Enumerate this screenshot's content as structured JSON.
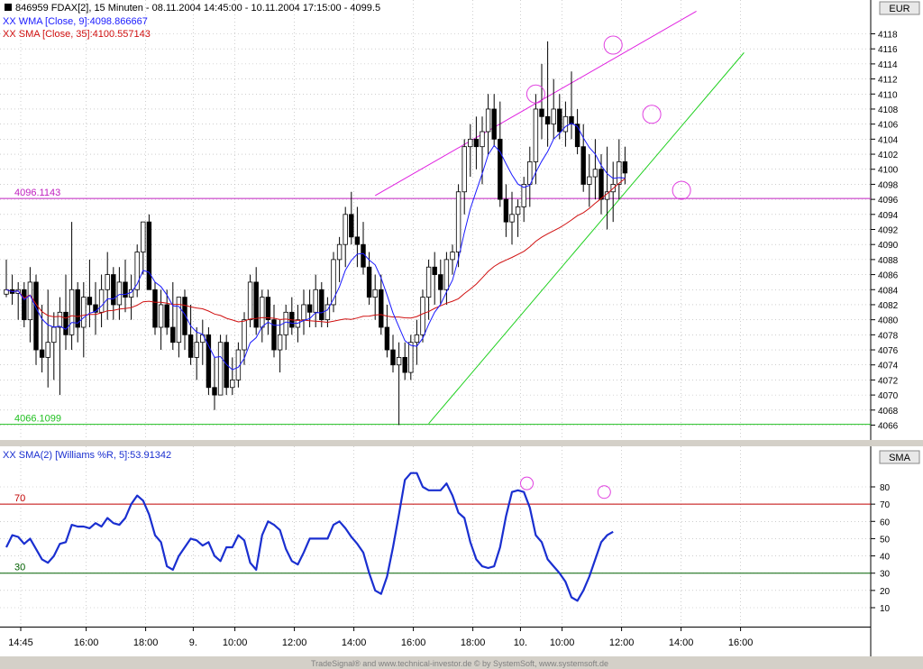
{
  "header": {
    "symbol_line": "846959  FDAX[2], 15 Minuten - 08.11.2004 14:45:00 - 10.11.2004 17:15:00 - 4099.5",
    "wma_label": "XX WMA [Close, 9]:4098.866667",
    "sma_label": "XX SMA [Close, 35]:4100.557143",
    "osc_label": "XX SMA(2) [Williams %R, 5]:53.91342",
    "currency": "EUR",
    "osc_axis_title": "SMA",
    "footer": "TradeSignal® and www.technical-investor.de © by  SystemSoft, www.systemsoft.de"
  },
  "colors": {
    "wma": "#1a1aff",
    "sma": "#d01010",
    "upper_channel": "#e020e0",
    "lower_channel": "#20d020",
    "level_upper": "#c020c0",
    "level_lower": "#20c020",
    "osc_line": "#1a2fd0",
    "osc_70": "#c00000",
    "osc_30": "#006000",
    "circles": "#e040e0"
  },
  "chart_data": [
    {
      "type": "candlestick",
      "ylim": [
        4064,
        4120
      ],
      "y_ticks": [
        4066,
        4068,
        4070,
        4072,
        4074,
        4076,
        4078,
        4080,
        4082,
        4084,
        4086,
        4088,
        4090,
        4092,
        4094,
        4096,
        4098,
        4100,
        4102,
        4104,
        4106,
        4108,
        4110,
        4112,
        4114,
        4116,
        4118
      ],
      "x_ticks": [
        "14:45",
        "16:00",
        "18:00",
        "9.",
        "10:00",
        "12:00",
        "14:00",
        "16:00",
        "18:00",
        "10.",
        "10:00",
        "12:00",
        "14:00",
        "16:00"
      ],
      "x_tick_index": [
        0,
        11,
        21,
        29,
        36,
        46,
        56,
        66,
        76,
        84,
        91,
        101,
        111,
        121
      ],
      "levels": [
        {
          "label": "4096.1143",
          "value": 4096.1143
        },
        {
          "label": "4066.1099",
          "value": 4066.1099
        }
      ],
      "trendlines": [
        {
          "name": "upper",
          "from": [
            62,
            4096.5
          ],
          "to": [
            116,
            4121
          ]
        },
        {
          "name": "lower",
          "from": [
            71,
            4066.2
          ],
          "to": [
            124,
            4115.5
          ]
        }
      ],
      "highlight_circles": [
        [
          89,
          4110
        ],
        [
          102,
          4116.5
        ],
        [
          108.5,
          4107.3
        ],
        [
          113.5,
          4097.2
        ]
      ],
      "candles": [
        [
          4083.4,
          4088,
          4083,
          4084
        ],
        [
          4084,
          4086,
          4082,
          4083.5
        ],
        [
          4083.5,
          4085,
          4080,
          4084
        ],
        [
          4084,
          4085,
          4079,
          4080
        ],
        [
          4080,
          4087,
          4077,
          4085
        ],
        [
          4085,
          4086,
          4074,
          4076
        ],
        [
          4076,
          4082,
          4073,
          4075
        ],
        [
          4075,
          4084,
          4071,
          4077
        ],
        [
          4077,
          4081,
          4072,
          4079
        ],
        [
          4079,
          4083,
          4070,
          4081
        ],
        [
          4081,
          4086,
          4076,
          4078
        ],
        [
          4078,
          4093,
          4076,
          4084
        ],
        [
          4084,
          4085,
          4077,
          4079
        ],
        [
          4079,
          4085,
          4075,
          4083
        ],
        [
          4083,
          4088,
          4079,
          4082
        ],
        [
          4082,
          4085,
          4078,
          4081
        ],
        [
          4081,
          4086,
          4079,
          4084
        ],
        [
          4084,
          4089,
          4080,
          4086
        ],
        [
          4086,
          4087,
          4080,
          4082
        ],
        [
          4082,
          4087,
          4080,
          4085
        ],
        [
          4085,
          4088,
          4081,
          4083
        ],
        [
          4083,
          4086,
          4080,
          4084
        ],
        [
          4084,
          4090,
          4083,
          4089
        ],
        [
          4089,
          4093,
          4086,
          4093
        ],
        [
          4093,
          4094,
          4084,
          4084
        ],
        [
          4084,
          4085,
          4078,
          4079
        ],
        [
          4079,
          4084,
          4076,
          4082
        ],
        [
          4082,
          4084,
          4078,
          4079
        ],
        [
          4079,
          4085,
          4076,
          4077
        ],
        [
          4077,
          4083,
          4075,
          4083
        ],
        [
          4083,
          4084,
          4076,
          4078
        ],
        [
          4078,
          4082,
          4074,
          4075
        ],
        [
          4075,
          4079,
          4072,
          4077
        ],
        [
          4077,
          4080,
          4074,
          4078
        ],
        [
          4078,
          4079,
          4070,
          4071
        ],
        [
          4071,
          4075,
          4068,
          4070
        ],
        [
          4070,
          4078,
          4070,
          4077
        ],
        [
          4077,
          4078,
          4070,
          4071
        ],
        [
          4071,
          4075,
          4070,
          4072
        ],
        [
          4072,
          4077,
          4071,
          4076
        ],
        [
          4076,
          4081,
          4074,
          4080
        ],
        [
          4080,
          4086,
          4079,
          4085
        ],
        [
          4085,
          4087,
          4078,
          4079
        ],
        [
          4079,
          4084,
          4077,
          4083
        ],
        [
          4083,
          4084,
          4078,
          4080
        ],
        [
          4080,
          4082,
          4075,
          4076
        ],
        [
          4076,
          4080,
          4073,
          4078
        ],
        [
          4078,
          4082,
          4076,
          4081
        ],
        [
          4081,
          4083,
          4078,
          4079
        ],
        [
          4079,
          4082,
          4077,
          4080
        ],
        [
          4080,
          4084,
          4078,
          4082
        ],
        [
          4082,
          4084,
          4079,
          4081
        ],
        [
          4081,
          4086,
          4079,
          4084
        ],
        [
          4084,
          4085,
          4079,
          4080
        ],
        [
          4080,
          4083,
          4079,
          4082
        ],
        [
          4082,
          4089,
          4081,
          4088
        ],
        [
          4088,
          4091,
          4085,
          4090
        ],
        [
          4090,
          4095,
          4087,
          4094
        ],
        [
          4094,
          4097,
          4090,
          4091
        ],
        [
          4091,
          4095,
          4087,
          4090
        ],
        [
          4090,
          4093,
          4086,
          4087
        ],
        [
          4087,
          4089,
          4082,
          4083
        ],
        [
          4083,
          4086,
          4080,
          4084
        ],
        [
          4084,
          4086,
          4078,
          4079
        ],
        [
          4079,
          4082,
          4075,
          4076
        ],
        [
          4076,
          4078,
          4073,
          4074
        ],
        [
          4074,
          4077,
          4066,
          4075
        ],
        [
          4075,
          4077,
          4072,
          4073
        ],
        [
          4073,
          4078,
          4072,
          4077
        ],
        [
          4077,
          4080,
          4074,
          4078
        ],
        [
          4078,
          4084,
          4077,
          4083
        ],
        [
          4083,
          4088,
          4080,
          4087
        ],
        [
          4087,
          4089,
          4082,
          4086
        ],
        [
          4086,
          4088,
          4082,
          4084
        ],
        [
          4084,
          4089,
          4082,
          4088
        ],
        [
          4088,
          4090,
          4086,
          4089
        ],
        [
          4089,
          4098,
          4087,
          4097
        ],
        [
          4097,
          4104,
          4094,
          4103
        ],
        [
          4103,
          4106,
          4099,
          4104
        ],
        [
          4104,
          4107,
          4100,
          4103
        ],
        [
          4103,
          4107,
          4098,
          4105
        ],
        [
          4105,
          4110,
          4102,
          4108
        ],
        [
          4108,
          4110,
          4103,
          4104
        ],
        [
          4104,
          4109,
          4095,
          4096
        ],
        [
          4096,
          4098,
          4091,
          4093
        ],
        [
          4093,
          4097,
          4090,
          4094
        ],
        [
          4094,
          4096,
          4091,
          4095
        ],
        [
          4095,
          4099,
          4093,
          4098
        ],
        [
          4098,
          4103,
          4095,
          4101
        ],
        [
          4101,
          4110,
          4098,
          4108
        ],
        [
          4108,
          4114,
          4104,
          4107
        ],
        [
          4107,
          4117,
          4103,
          4106
        ],
        [
          4106,
          4112,
          4104,
          4108
        ],
        [
          4108,
          4110,
          4104,
          4105
        ],
        [
          4105,
          4109,
          4103,
          4107
        ],
        [
          4107,
          4113,
          4104,
          4106
        ],
        [
          4106,
          4108,
          4102,
          4103
        ],
        [
          4103,
          4106,
          4097,
          4098
        ],
        [
          4098,
          4102,
          4095,
          4099
        ],
        [
          4099,
          4104,
          4096,
          4100
        ],
        [
          4100,
          4102,
          4094,
          4096
        ],
        [
          4096,
          4103,
          4092,
          4097
        ],
        [
          4097,
          4101,
          4093,
          4098
        ],
        [
          4098,
          4104,
          4096,
          4101
        ],
        [
          4101,
          4103,
          4098,
          4099.5
        ]
      ]
    },
    {
      "type": "line",
      "title": "SMA(2) [Williams %R, 5]",
      "ylim": [
        0,
        100
      ],
      "y_ticks": [
        10,
        20,
        30,
        40,
        50,
        60,
        70,
        80
      ],
      "levels": [
        {
          "label": "70",
          "value": 70
        },
        {
          "label": "30",
          "value": 30
        }
      ],
      "highlight_circles": [
        [
          87.5,
          82
        ],
        [
          100.5,
          77
        ]
      ],
      "series": [
        {
          "name": "SMA(2) [Williams %R, 5]",
          "values": [
            45,
            52,
            51,
            47,
            50,
            44,
            38,
            36,
            40,
            47,
            48,
            58,
            57,
            57,
            56,
            59,
            57,
            62,
            59,
            58,
            62,
            70,
            75,
            72,
            64,
            52,
            48,
            34,
            32,
            40,
            45,
            50,
            49,
            46,
            48,
            40,
            37,
            45,
            45,
            52,
            49,
            36,
            32,
            52,
            60,
            58,
            55,
            44,
            37,
            35,
            42,
            50,
            50,
            50,
            50,
            58,
            60,
            56,
            51,
            47,
            42,
            30,
            20,
            18,
            28,
            45,
            64,
            84,
            88,
            88,
            80,
            78,
            78,
            78,
            82,
            75,
            65,
            62,
            48,
            38,
            34,
            33,
            34,
            45,
            63,
            77,
            78,
            77,
            68,
            52,
            48,
            38,
            34,
            30,
            25,
            16,
            14,
            20,
            28,
            38,
            48,
            52,
            54
          ]
        }
      ]
    }
  ]
}
